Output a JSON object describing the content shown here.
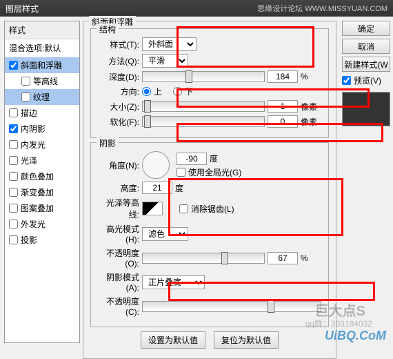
{
  "titlebar": {
    "title": "图层样式",
    "site": "思缘设计论坛 WWW.MISSYUAN.COM"
  },
  "sidebar": {
    "header": "样式",
    "blend": "混合选项:默认",
    "items": [
      {
        "label": "斜面和浮雕",
        "checked": true,
        "sel": true
      },
      {
        "label": "等高线",
        "checked": false,
        "indent": true
      },
      {
        "label": "纹理",
        "checked": false,
        "indent": true,
        "sel": true
      },
      {
        "label": "描边",
        "checked": false
      },
      {
        "label": "内阴影",
        "checked": true
      },
      {
        "label": "内发光",
        "checked": false
      },
      {
        "label": "光泽",
        "checked": false
      },
      {
        "label": "颜色叠加",
        "checked": false
      },
      {
        "label": "渐变叠加",
        "checked": false
      },
      {
        "label": "图案叠加",
        "checked": false
      },
      {
        "label": "外发光",
        "checked": false
      },
      {
        "label": "投影",
        "checked": false
      }
    ]
  },
  "panel": {
    "title": "斜面和浮雕",
    "struct": {
      "title": "结构",
      "styleLabel": "样式(T):",
      "styleValue": "外斜面",
      "methodLabel": "方法(Q):",
      "methodValue": "平滑",
      "depthLabel": "深度(D):",
      "depthValue": "184",
      "depthUnit": "%",
      "dirLabel": "方向:",
      "up": "上",
      "down": "下",
      "sizeLabel": "大小(Z):",
      "sizeValue": "1",
      "sizeUnit": "像素",
      "softLabel": "软化(F):",
      "softValue": "0",
      "softUnit": "像素"
    },
    "shade": {
      "title": "阴影",
      "angleLabel": "角度(N):",
      "angleValue": "-90",
      "angleUnit": "度",
      "globalLabel": "使用全局光(G)",
      "altLabel": "高度:",
      "altValue": "21",
      "altUnit": "度",
      "glossLabel": "光泽等高线:",
      "aaLabel": "消除锯齿(L)",
      "hiModeLabel": "高光模式(H):",
      "hiModeValue": "滤色",
      "hiOpLabel": "不透明度(O):",
      "hiOpValue": "67",
      "hiOpUnit": "%",
      "shModeLabel": "阴影模式(A):",
      "shModeValue": "正片叠底",
      "shOpLabel": "不透明度(C):"
    },
    "defaults": {
      "set": "设置为默认值",
      "reset": "复位为默认值"
    }
  },
  "buttons": {
    "ok": "确定",
    "cancel": "取消",
    "new": "新建样式(W",
    "preview": "预览(V)"
  },
  "watermark": {
    "logo": "UiBQ.CoM",
    "big": "巨大点S",
    "qq": "qq群：303184032"
  }
}
